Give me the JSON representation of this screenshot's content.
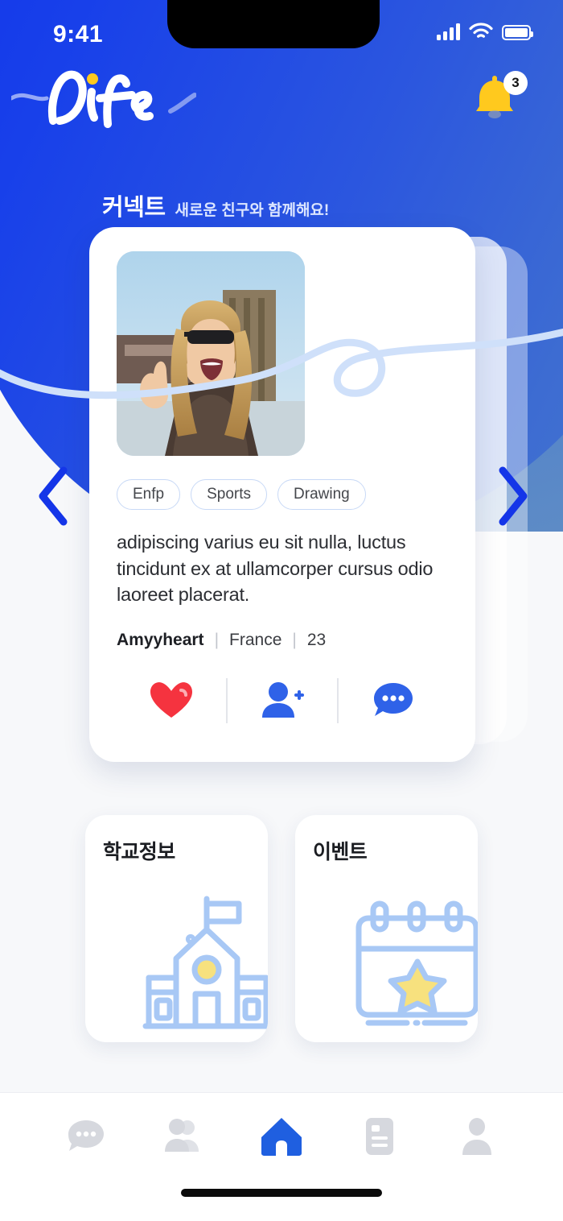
{
  "status_bar": {
    "time": "9:41",
    "signal_icon": "cellular-signal-icon",
    "wifi_icon": "wifi-icon",
    "battery_icon": "battery-icon"
  },
  "header": {
    "logo_text": "Dife",
    "notification_icon": "bell-icon",
    "notification_count": "3"
  },
  "section": {
    "title": "커넥트",
    "subtitle": "새로운 친구와 함께해요!"
  },
  "carousel": {
    "prev_label": "‹",
    "next_label": "›",
    "prev_icon": "chevron-left-icon",
    "next_icon": "chevron-right-icon"
  },
  "profile": {
    "avatar_alt": "profile-photo",
    "tags": [
      "Enfp",
      "Sports",
      "Drawing"
    ],
    "bio": "adipiscing varius eu sit nulla, luctus tincidunt ex at ullamcorper cursus odio laoreet placerat.",
    "name": "Amyyheart",
    "country": "France",
    "age": "23",
    "separator": "|",
    "actions": [
      {
        "name": "like-button",
        "icon": "heart-icon"
      },
      {
        "name": "add-friend-button",
        "icon": "person-add-icon"
      },
      {
        "name": "message-button",
        "icon": "chat-bubble-icon"
      }
    ]
  },
  "tiles": [
    {
      "title": "학교정보",
      "icon": "school-building-icon"
    },
    {
      "title": "이벤트",
      "icon": "calendar-star-icon"
    }
  ],
  "tabbar": {
    "items": [
      {
        "name": "tab-chat",
        "icon": "chat-bubble-icon",
        "active": false
      },
      {
        "name": "tab-friends",
        "icon": "people-icon",
        "active": false
      },
      {
        "name": "tab-home",
        "icon": "home-icon",
        "active": true
      },
      {
        "name": "tab-board",
        "icon": "document-icon",
        "active": false
      },
      {
        "name": "tab-profile",
        "icon": "person-icon",
        "active": false
      }
    ]
  },
  "colors": {
    "brand_blue": "#1435E8",
    "accent_blue": "#2F62E8",
    "like_red": "#F5333F",
    "bell_yellow": "#FFC91E",
    "icon_light_blue": "#A8C8F5",
    "star_yellow": "#F7E17E",
    "page_bg": "#F7F8FA"
  }
}
